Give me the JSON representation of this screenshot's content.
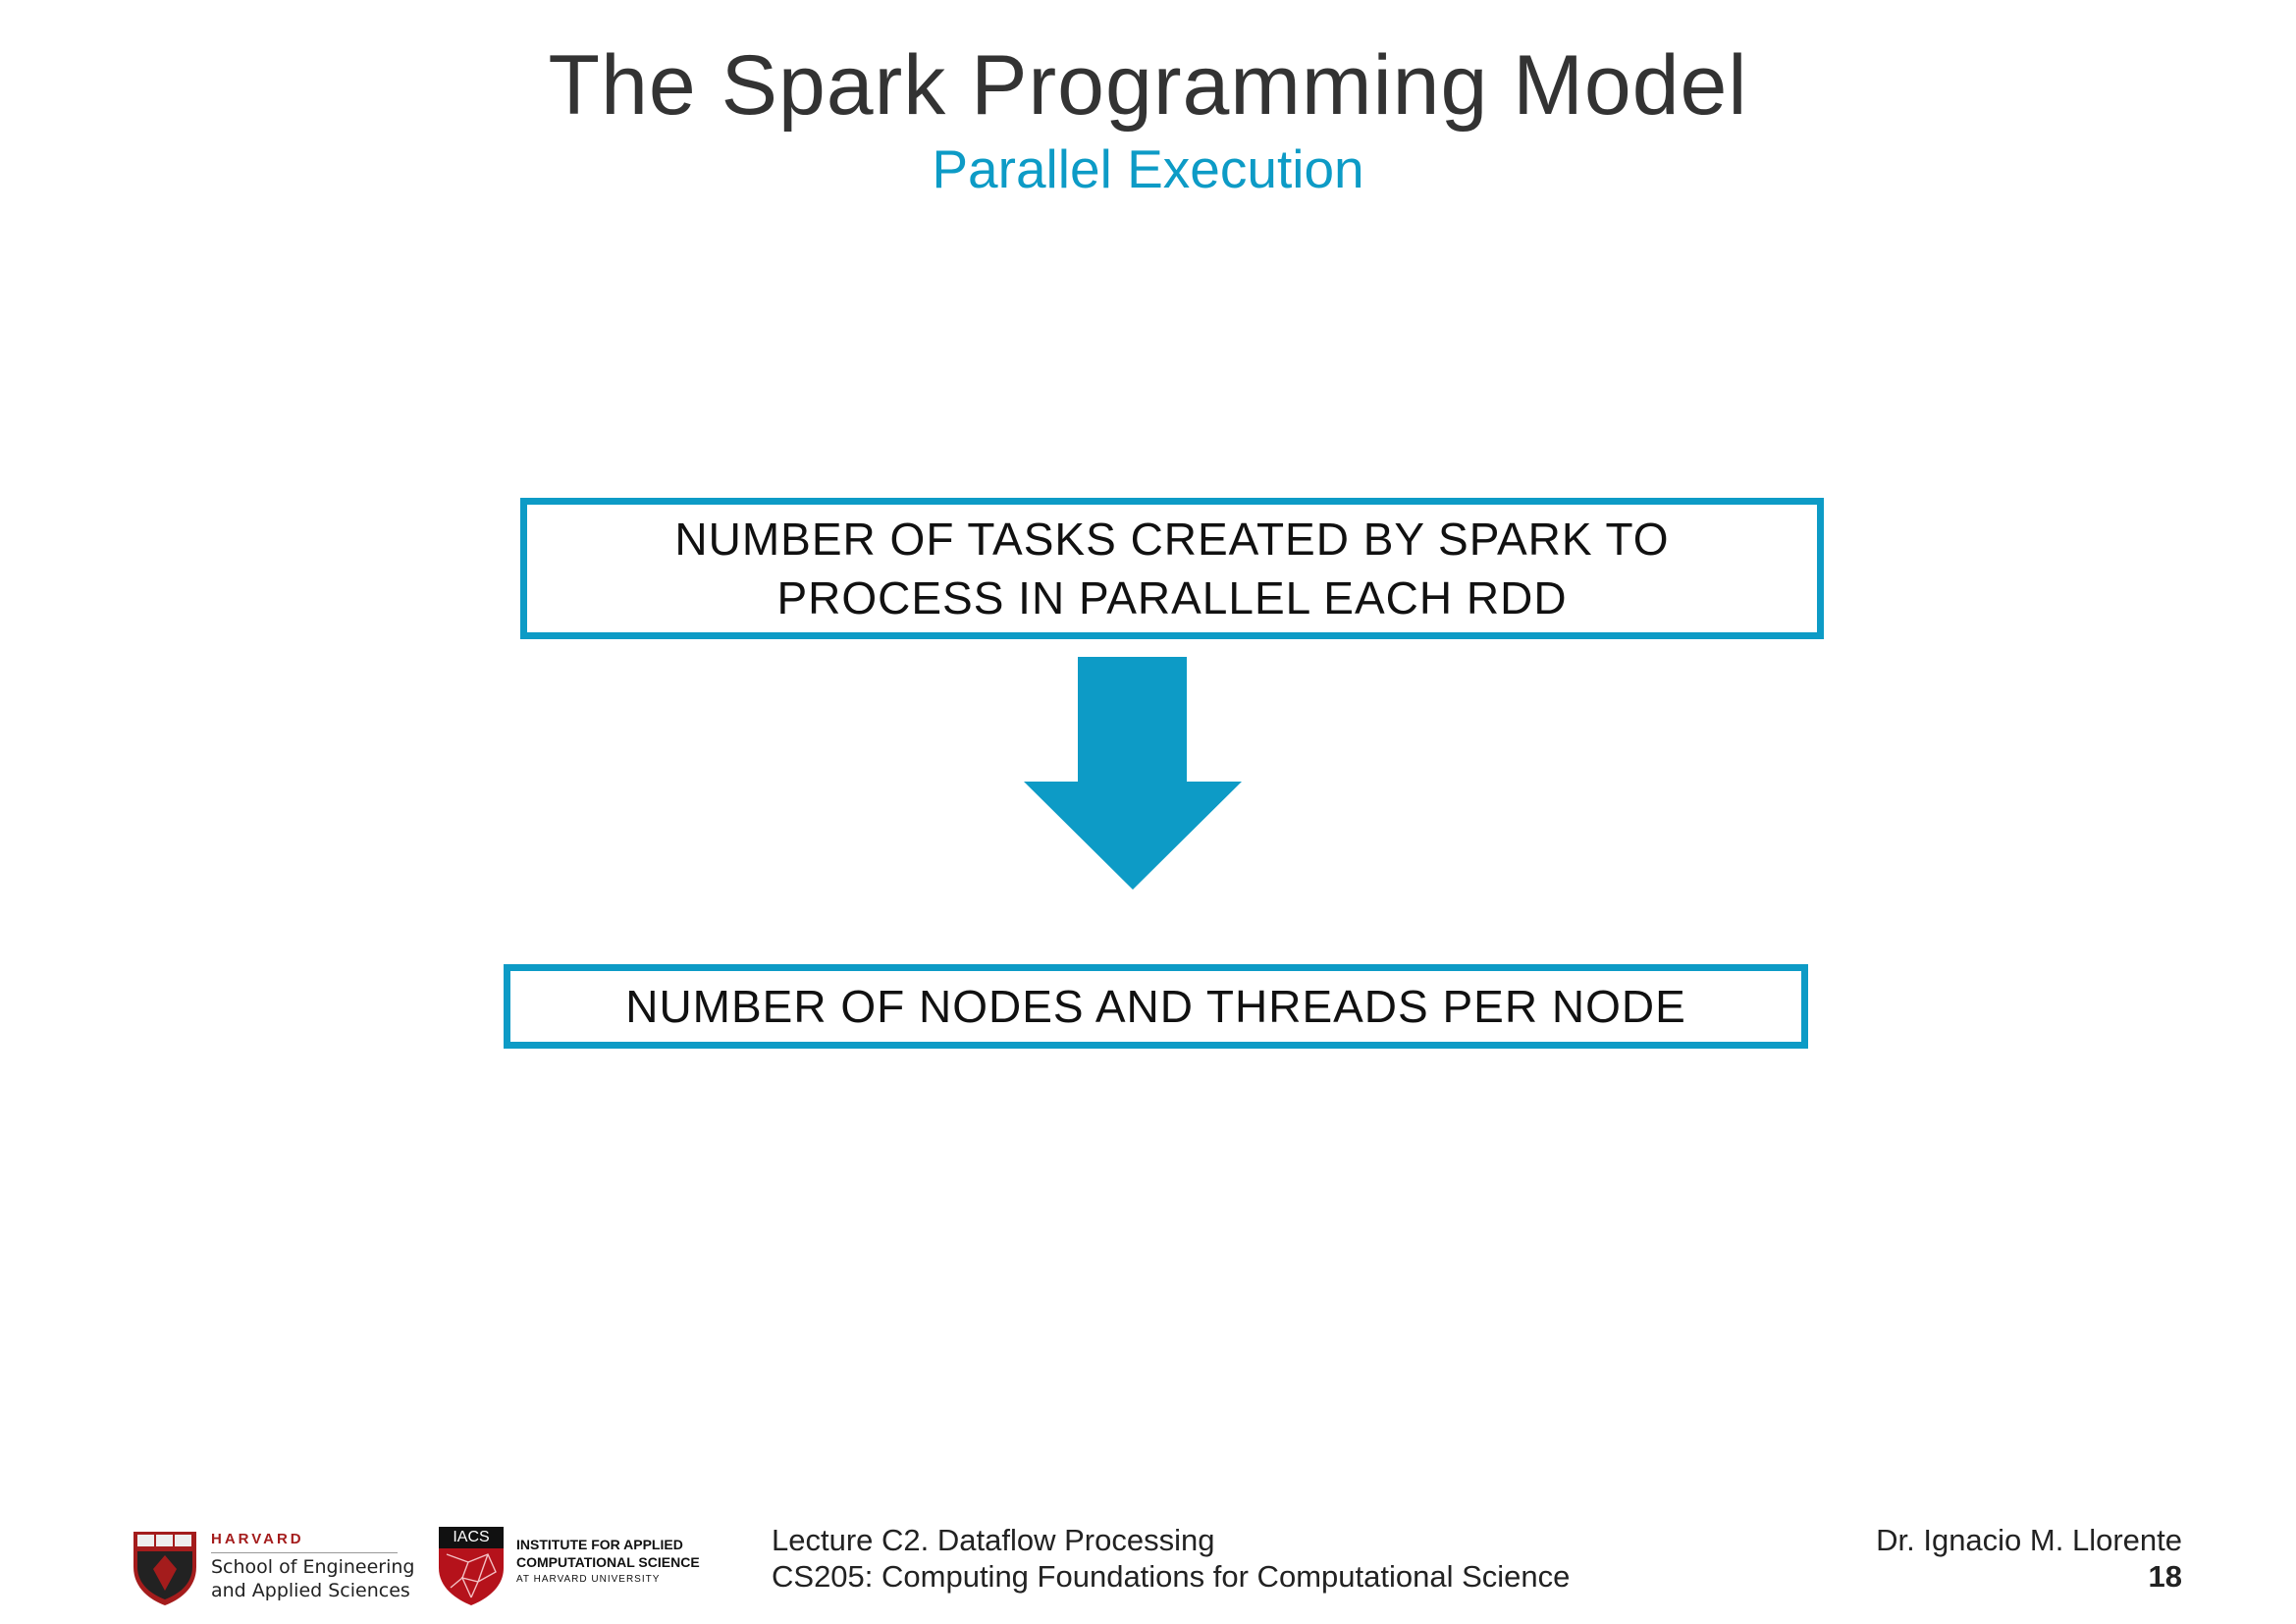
{
  "slide": {
    "title": "The Spark Programming Model",
    "subtitle": "Parallel Execution"
  },
  "diagram": {
    "top_box": [
      "NUMBER OF TASKS CREATED BY SPARK TO",
      "PROCESS IN PARALLEL EACH RDD"
    ],
    "bottom_box": "NUMBER OF NODES AND THREADS PER NODE",
    "arrow_icon": "arrow-down-icon",
    "accent_color": "#0d9bc6"
  },
  "footer": {
    "harvard": {
      "name": "HARVARD",
      "line2": "School of Engineering",
      "line3": "and Applied Sciences"
    },
    "iacs": {
      "badge": "IACS",
      "line1": "INSTITUTE FOR APPLIED",
      "line2": "COMPUTATIONAL SCIENCE",
      "line3": "AT HARVARD UNIVERSITY"
    },
    "lecture_line1": "Lecture C2. Dataflow Processing",
    "lecture_line2": "CS205: Computing Foundations for Computational Science",
    "author": "Dr. Ignacio M. Llorente",
    "page_number": "18"
  }
}
